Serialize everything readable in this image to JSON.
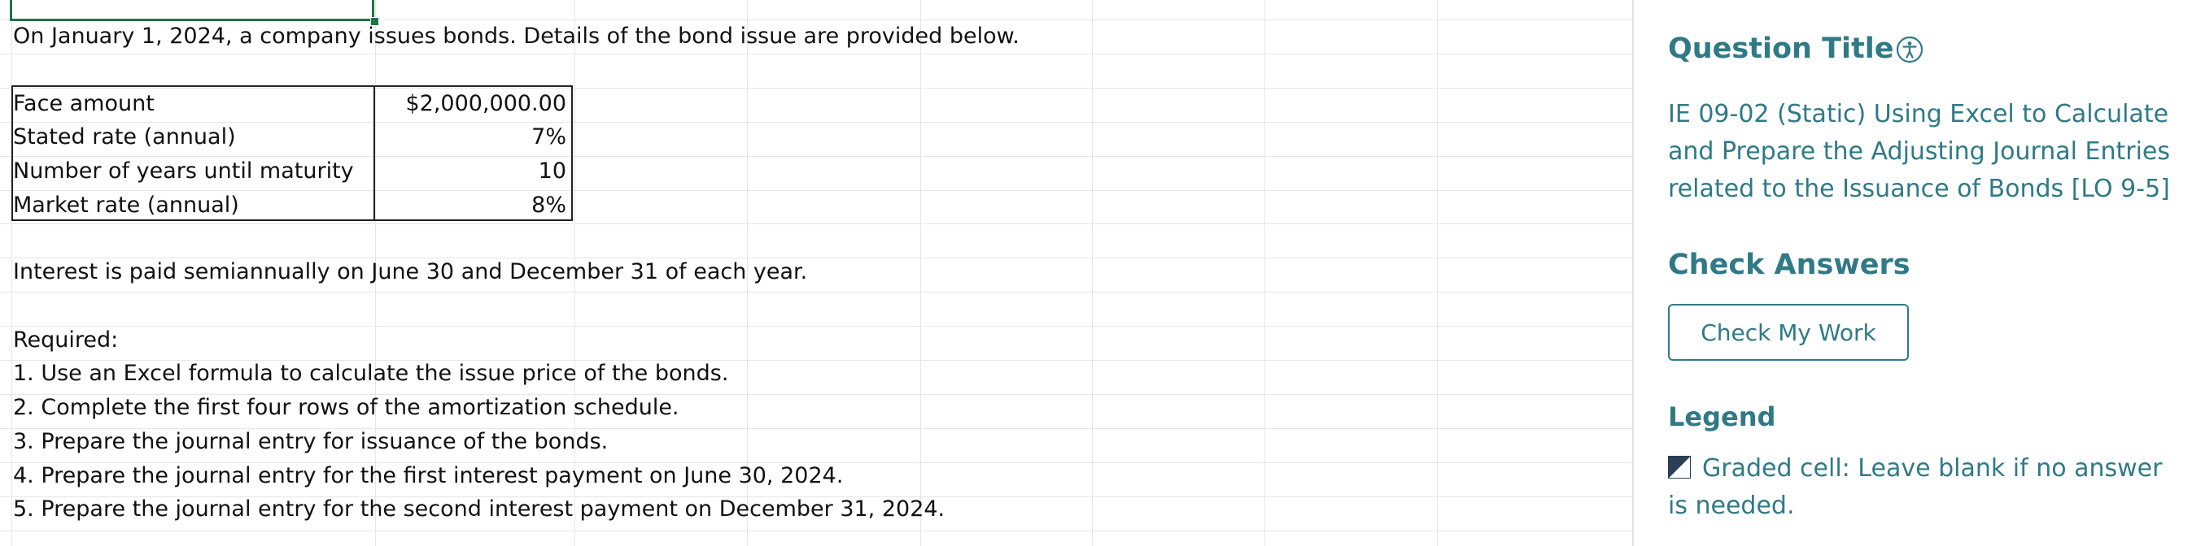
{
  "sheet": {
    "intro": "On January 1, 2024, a company issues bonds. Details of the bond issue are provided below.",
    "details": [
      {
        "label": "Face amount",
        "value": "$2,000,000.00"
      },
      {
        "label": "Stated rate (annual)",
        "value": "7%"
      },
      {
        "label": "Number of years until maturity",
        "value": "10"
      },
      {
        "label": "Market rate (annual)",
        "value": "8%"
      }
    ],
    "interest_note": "Interest is paid semiannually on June 30 and December 31 of each year.",
    "required_heading": "Required:",
    "required": [
      "1. Use an Excel formula to calculate the issue price of the bonds.",
      "2. Complete the first four rows of the amortization schedule.",
      "3. Prepare the journal entry for issuance of the bonds.",
      "4. Prepare the journal entry for the first interest payment on June 30, 2024.",
      "5. Prepare the journal entry for the second interest payment on December 31, 2024."
    ]
  },
  "panel": {
    "question_title_heading": "Question Title",
    "accessibility_icon": "accessibility-icon",
    "question_title": "IE 09-02 (Static) Using Excel to Calculate and Prepare the Adjusting Journal Entries related to the Issuance of Bonds [LO 9-5]",
    "check_answers_heading": "Check Answers",
    "check_button_label": "Check My Work",
    "legend_heading": "Legend",
    "legend_icon": "graded-cell-icon",
    "legend_text": "Graded cell: Leave blank if no answer is needed.",
    "accent_color": "#2f7a86"
  }
}
